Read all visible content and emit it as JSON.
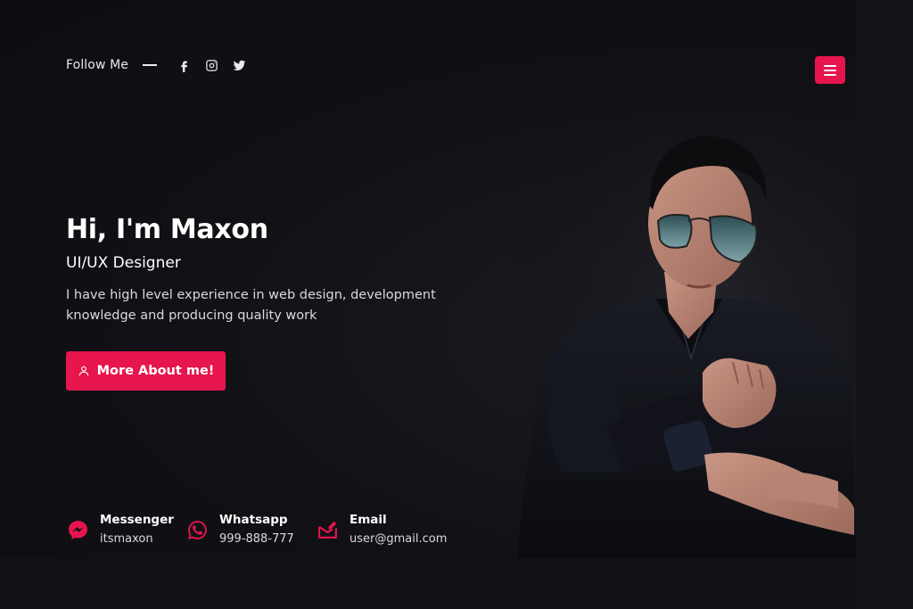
{
  "follow": {
    "label": "Follow Me",
    "socials": [
      "facebook-icon",
      "instagram-icon",
      "twitter-icon"
    ]
  },
  "menu": {
    "icon": "hamburger-icon"
  },
  "hero": {
    "title": "Hi, I'm Maxon",
    "role": "UI/UX Designer",
    "description": "I have high level experience in web design, development knowledge and producing quality work",
    "cta_label": "More About me!"
  },
  "contacts": [
    {
      "icon": "messenger-icon",
      "title": "Messenger",
      "value": "itsmaxon"
    },
    {
      "icon": "whatsapp-icon",
      "title": "Whatsapp",
      "value": "999-888-777"
    },
    {
      "icon": "email-icon",
      "title": "Email",
      "value": "user@gmail.com"
    }
  ],
  "colors": {
    "accent": "#e6154d",
    "background": "#111115",
    "text": "#ffffff",
    "muted": "#d9d9df"
  }
}
